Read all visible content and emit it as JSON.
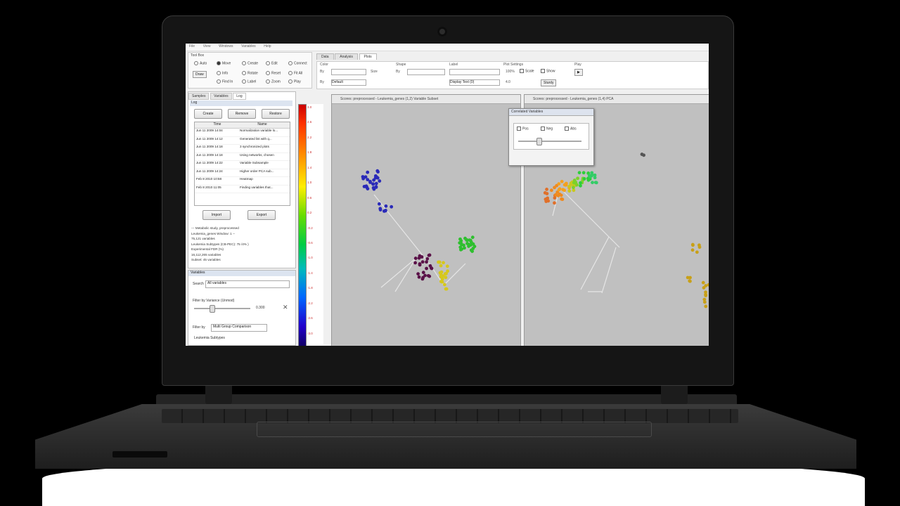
{
  "screen": {
    "menu": [
      "File",
      "View",
      "Windows",
      "Variables",
      "Help"
    ],
    "toolbox": {
      "title": "Tool Box",
      "row1": [
        "Auto",
        "Move",
        "Create",
        "Edit",
        "Connect"
      ],
      "row2": [
        "Info",
        "Rotate",
        "Reset",
        "Resolve",
        "Fit All"
      ],
      "row3": [
        "",
        "Find In",
        "Label",
        "Zoom",
        "Play"
      ],
      "button": "Draw"
    },
    "tabs": [
      "Data",
      "Analysis",
      "Plots"
    ],
    "tab_panel": {
      "groups": [
        "Color",
        "Shape",
        "Label",
        "Plot Settings",
        "Play"
      ],
      "fields": [
        "By",
        "Size",
        "By",
        "Size",
        "Rotate"
      ],
      "combos": [
        "Default",
        "Display Text (0)"
      ],
      "checks": [
        "Scale",
        "Show"
      ],
      "values": [
        "100%",
        "4.0",
        "Sturdy"
      ]
    },
    "left_panel": {
      "tabs": [
        "Samples",
        "Variables",
        "Log"
      ],
      "header": "Log",
      "buttons": [
        "Create",
        "Remove",
        "Restore"
      ],
      "columns": [
        "Time",
        "Name"
      ],
      "rows": [
        {
          "time": "Jun 11 2009 14:04",
          "name": "Normalization variable lo..."
        },
        {
          "time": "Jun 11 2009 14:12",
          "name": "Generated list with q..."
        },
        {
          "time": "Jun 11 2009 14:18",
          "name": "3 synchronized plots"
        },
        {
          "time": "Jun 11 2009 14:18",
          "name": "Using networks, chosen"
        },
        {
          "time": "Jun 11 2009 14:22",
          "name": "Variable Subsample"
        },
        {
          "time": "Jun 11 2009 14:24",
          "name": "Higher order PCA sub..."
        },
        {
          "time": "Feb 8 2010 10:58",
          "name": "Heatmap"
        },
        {
          "time": "Feb 8 2010 11:05",
          "name": "Finding variables that..."
        }
      ],
      "export_buttons": [
        "Import",
        "Export"
      ],
      "console": [
        "--- Metabolic study, preprocessed",
        "Leukemia_genes Window: 1 --",
        "75,121 variables",
        "Leukemia Subtypes (CB-PEC): 75 /4% )",
        "Experimental FDR (%)",
        "16,112,265 variables",
        "Subset: 45 variables"
      ]
    },
    "variables_panel": {
      "title": "Variables",
      "search_label": "Search",
      "search_value": "All variables",
      "filter_label": "Filter by Variance (Unmod)",
      "filter_value": "0.300",
      "filter2_label": "Filter by",
      "filter2_value": "Multi Group Comparison",
      "subset_value": "Leukemia Subtypes"
    },
    "colorbar_values": [
      "3.0",
      "2.6",
      "2.2",
      "1.8",
      "1.4",
      "1.0",
      "0.6",
      "0.2",
      "-0.2",
      "-0.6",
      "-1.0",
      "-1.4",
      "-1.8",
      "-2.2",
      "-2.6",
      "-3.0"
    ],
    "plot1": {
      "title": "Scores: preprocessed - Leukemia_genes (1,2) Variable Subset"
    },
    "plot2": {
      "title": "Scores: preprocessed - Leukemia_genes (1,4) PCA"
    },
    "float_window": {
      "title": "Correlated Variables",
      "options": [
        "Pos",
        "Neg",
        "Abs"
      ]
    }
  }
}
